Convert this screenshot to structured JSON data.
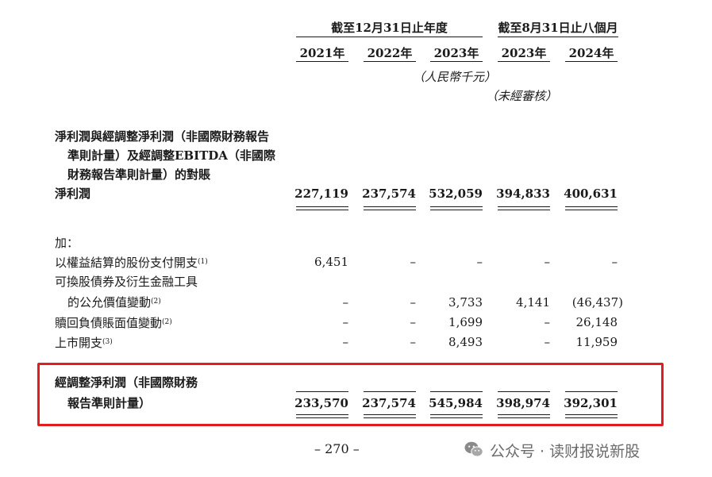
{
  "header": {
    "period_full_year": "截至12月31日止年度",
    "period_eight_months": "截至8月31日止八個月",
    "years": [
      "2021年",
      "2022年",
      "2023年",
      "2023年",
      "2024年"
    ],
    "currency_note": "（人民幣千元）",
    "unaudited_note": "（未經審核）"
  },
  "section_title": {
    "lines": [
      "淨利潤與經調整淨利潤（非國際財務報告",
      "準則計量）及經調整EBITDA（非國際",
      "財務報告準則計量）的對賬"
    ]
  },
  "net_profit": {
    "label": "淨利潤",
    "values": [
      "227,119",
      "237,574",
      "532,059",
      "394,833",
      "400,631"
    ]
  },
  "add_label": "加：",
  "rows": [
    {
      "label": "以權益結算的股份支付開支",
      "note": "(1)",
      "values": [
        "6,451",
        "–",
        "–",
        "–",
        "–"
      ]
    },
    {
      "label": "可換股債券及衍生金融工具",
      "label2": "的公允價值變動",
      "note": "(2)",
      "values": [
        "–",
        "–",
        "3,733",
        "4,141",
        "(46,437)"
      ]
    },
    {
      "label": "贖回負債賬面值變動",
      "note": "(2)",
      "values": [
        "–",
        "–",
        "1,699",
        "–",
        "26,148"
      ]
    },
    {
      "label": "上市開支",
      "note": "(3)",
      "values": [
        "–",
        "–",
        "8,493",
        "–",
        "11,959"
      ]
    }
  ],
  "adjusted": {
    "label_line1": "經調整淨利潤（非國際財務",
    "label_line2": "報告準則計量）",
    "values": [
      "233,570",
      "237,574",
      "545,984",
      "398,974",
      "392,301"
    ]
  },
  "page_number": "– 270 –",
  "watermark": {
    "text": "公众号 · 读财报说新股",
    "icon": "wechat-icon"
  },
  "colors": {
    "highlight_box": "#e21d1d",
    "text": "#1a1a1a",
    "watermark": "#6b6b6b"
  }
}
